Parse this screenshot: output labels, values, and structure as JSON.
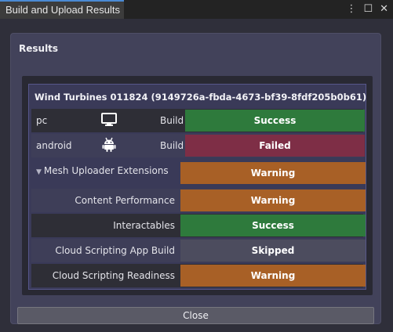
{
  "window": {
    "tab_title": "Build and Upload Results"
  },
  "panel": {
    "title": "Results",
    "build_name": "Wind Turbines 011824 (9149726a-fbda-4673-bf39-8fdf205b0b61)",
    "platforms": [
      {
        "name": "pc",
        "icon": "monitor-icon",
        "build_label": "Build",
        "status": "Success"
      },
      {
        "name": "android",
        "icon": "android-icon",
        "build_label": "Build",
        "status": "Failed"
      }
    ],
    "extensions": {
      "label": "Mesh Uploader Extensions",
      "status": "Warning",
      "checks": [
        {
          "label": "Content Performance",
          "status": "Warning"
        },
        {
          "label": "Interactables",
          "status": "Success"
        },
        {
          "label": "Cloud Scripting App Build",
          "status": "Skipped"
        },
        {
          "label": "Cloud Scripting Readiness",
          "status": "Warning"
        }
      ]
    },
    "close_label": "Close"
  },
  "colors": {
    "success": "#2e7a3c",
    "failed": "#7e2e46",
    "warning": "#a86026",
    "skipped": "#4c4c5e",
    "tab_accent": "#4a8ad4"
  }
}
